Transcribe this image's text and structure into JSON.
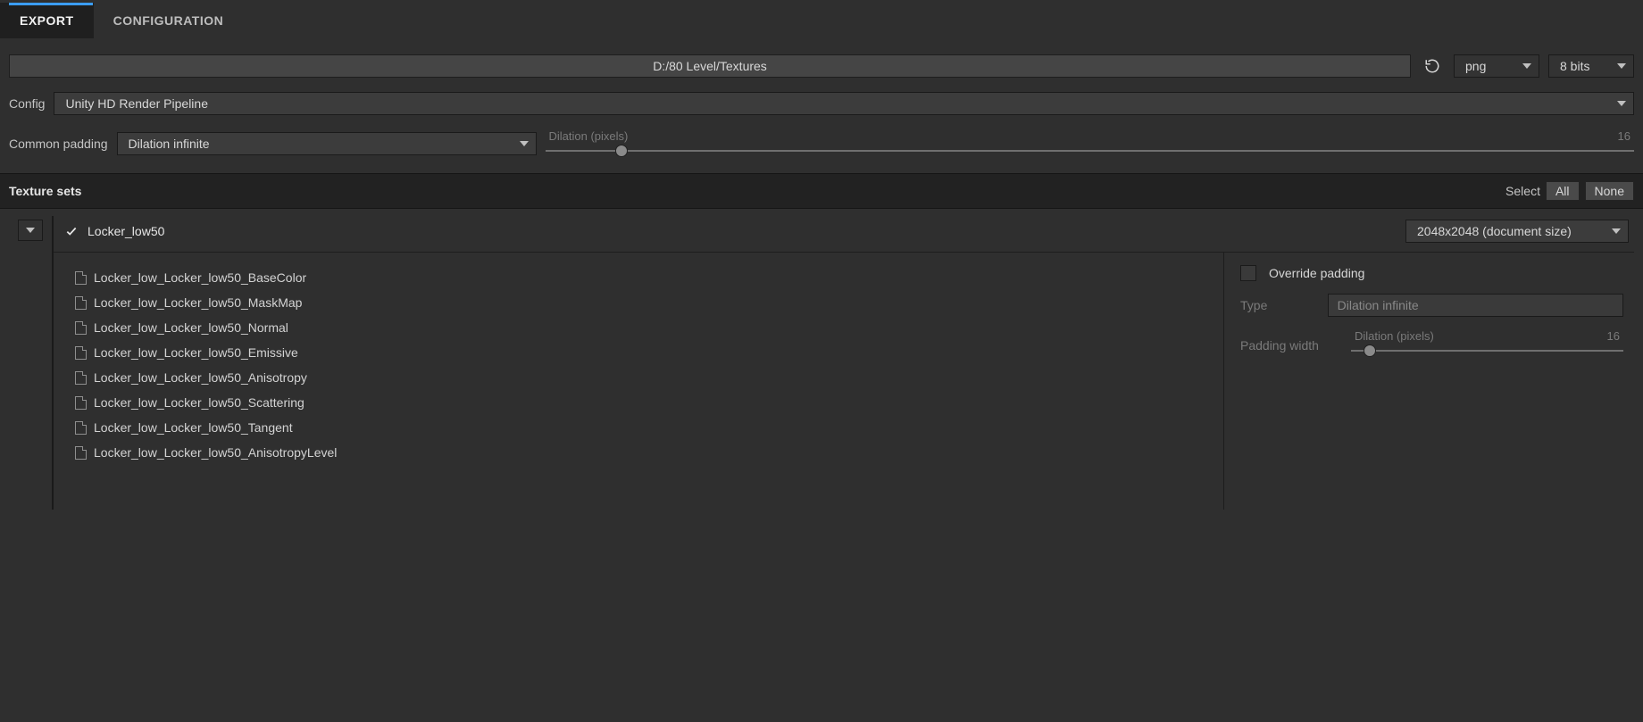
{
  "tabs": {
    "export": "EXPORT",
    "config": "CONFIGURATION",
    "active": "export"
  },
  "path": "D:/80 Level/Textures",
  "format": "png",
  "bit_depth": "8 bits",
  "config_label": "Config",
  "config_value": "Unity HD Render Pipeline",
  "common_padding_label": "Common padding",
  "common_padding_value": "Dilation infinite",
  "dilation_label": "Dilation (pixels)",
  "dilation_value": "16",
  "dilation_percent": 7,
  "section_title": "Texture sets",
  "select_label": "Select",
  "select_all": "All",
  "select_none": "None",
  "set": {
    "name": "Locker_low50",
    "checked": true,
    "size": "2048x2048 (document size)",
    "files": [
      "Locker_low_Locker_low50_BaseColor",
      "Locker_low_Locker_low50_MaskMap",
      "Locker_low_Locker_low50_Normal",
      "Locker_low_Locker_low50_Emissive",
      "Locker_low_Locker_low50_Anisotropy",
      "Locker_low_Locker_low50_Scattering",
      "Locker_low_Locker_low50_Tangent",
      "Locker_low_Locker_low50_AnisotropyLevel"
    ],
    "override_label": "Override padding",
    "type_label": "Type",
    "type_value": "Dilation infinite",
    "padding_width_label": "Padding width",
    "padding_dilation_label": "Dilation (pixels)",
    "padding_dilation_value": "16",
    "padding_dilation_percent": 7
  }
}
